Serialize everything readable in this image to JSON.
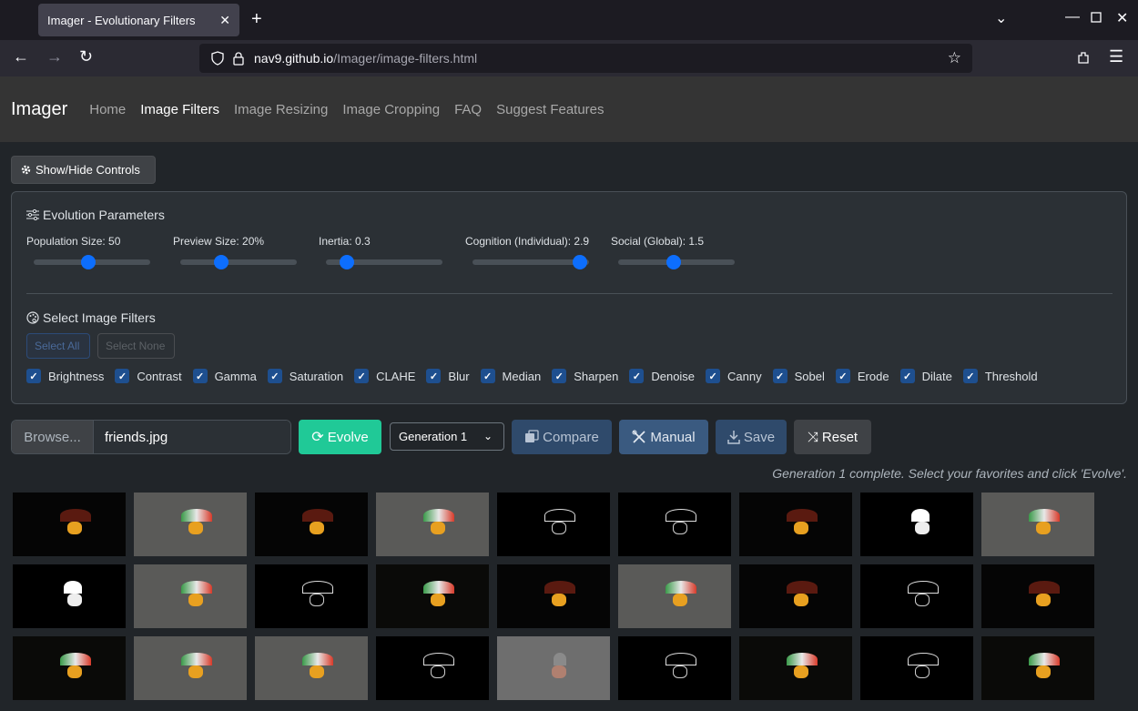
{
  "browser": {
    "tab_title": "Imager - Evolutionary Filters",
    "url_host": "nav9.github.io",
    "url_path": "/Imager/image-filters.html"
  },
  "nav": {
    "brand": "Imager",
    "links": [
      {
        "label": "Home",
        "active": false
      },
      {
        "label": "Image Filters",
        "active": true
      },
      {
        "label": "Image Resizing",
        "active": false
      },
      {
        "label": "Image Cropping",
        "active": false
      },
      {
        "label": "FAQ",
        "active": false
      },
      {
        "label": "Suggest Features",
        "active": false
      }
    ]
  },
  "controls": {
    "toggle_label": "Show/Hide Controls",
    "evolution_title": "Evolution Parameters",
    "sliders": [
      {
        "label": "Population Size: 50",
        "fraction": 0.47
      },
      {
        "label": "Preview Size: 20%",
        "fraction": 0.35
      },
      {
        "label": "Inertia: 0.3",
        "fraction": 0.18
      },
      {
        "label": "Cognition (Individual): 2.9",
        "fraction": 0.92
      },
      {
        "label": "Social (Global): 1.5",
        "fraction": 0.48
      }
    ],
    "filters_title": "Select Image Filters",
    "select_all": "Select All",
    "select_none": "Select None",
    "filters": [
      "Brightness",
      "Contrast",
      "Gamma",
      "Saturation",
      "CLAHE",
      "Blur",
      "Median",
      "Sharpen",
      "Denoise",
      "Canny",
      "Sobel",
      "Erode",
      "Dilate",
      "Threshold"
    ]
  },
  "actions": {
    "browse": "Browse...",
    "filename": "friends.jpg",
    "evolve": "Evolve",
    "generation": "Generation 1",
    "compare": "Compare",
    "manual": "Manual",
    "save": "Save",
    "reset": "Reset"
  },
  "status": "Generation 1 complete. Select your favorites and click 'Evolve'.",
  "gallery": {
    "thumbnail_count": 27,
    "styles": [
      "dark",
      "washed",
      "dark",
      "washed",
      "edges",
      "edges",
      "dark",
      "threshold",
      "washed",
      "threshold",
      "washed",
      "edges",
      "color",
      "dark",
      "washed",
      "dark",
      "edges",
      "dark",
      "color",
      "washed",
      "washed",
      "edges",
      "gray",
      "edges",
      "color",
      "edges",
      "color"
    ]
  },
  "colors": {
    "accent": "#0d6efd",
    "evolve": "#20c997",
    "background": "#212529"
  }
}
